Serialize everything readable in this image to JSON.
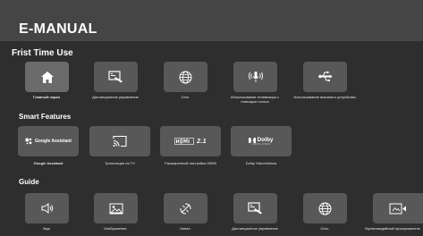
{
  "header": {
    "title": "E-MANUAL"
  },
  "sections": {
    "first_time_use": {
      "title": "Frist Time Use",
      "items": [
        {
          "label": "Главный экран",
          "icon": "home-icon"
        },
        {
          "label": "Дистанционное управление",
          "icon": "remote-control-icon"
        },
        {
          "label": "Сеть",
          "icon": "globe-icon"
        },
        {
          "label": "Использование телевизора с помощью голоса",
          "icon": "voice-mic-icon"
        },
        {
          "label": "Использование внешнего устройства",
          "icon": "usb-icon"
        }
      ]
    },
    "smart_features": {
      "title": "Smart Features",
      "items": [
        {
          "label": "Google Assistant",
          "icon": "google-assistant-icon",
          "badge": "Google Assistant"
        },
        {
          "label": "Трансляция на TV",
          "icon": "cast-icon"
        },
        {
          "label": "Расширенный настройка HDMI",
          "icon": "hdmi-icon",
          "badge": "2.1"
        },
        {
          "label": "Dolby Vision/Atmos",
          "icon": "dolby-icon",
          "badge": "Dolby",
          "badge_sub": "VISION·ATMOS"
        }
      ]
    },
    "guide": {
      "title": "Guide",
      "items": [
        {
          "label": "Звук",
          "icon": "speaker-icon"
        },
        {
          "label": "Изображение",
          "icon": "picture-icon"
        },
        {
          "label": "Канал",
          "icon": "satellite-icon"
        },
        {
          "label": "Дистанционное управление",
          "icon": "remote-control-icon"
        },
        {
          "label": "Сеть",
          "icon": "globe-icon"
        },
        {
          "label": "Мультимедийный проигрыватель",
          "icon": "media-player-icon"
        }
      ]
    }
  }
}
